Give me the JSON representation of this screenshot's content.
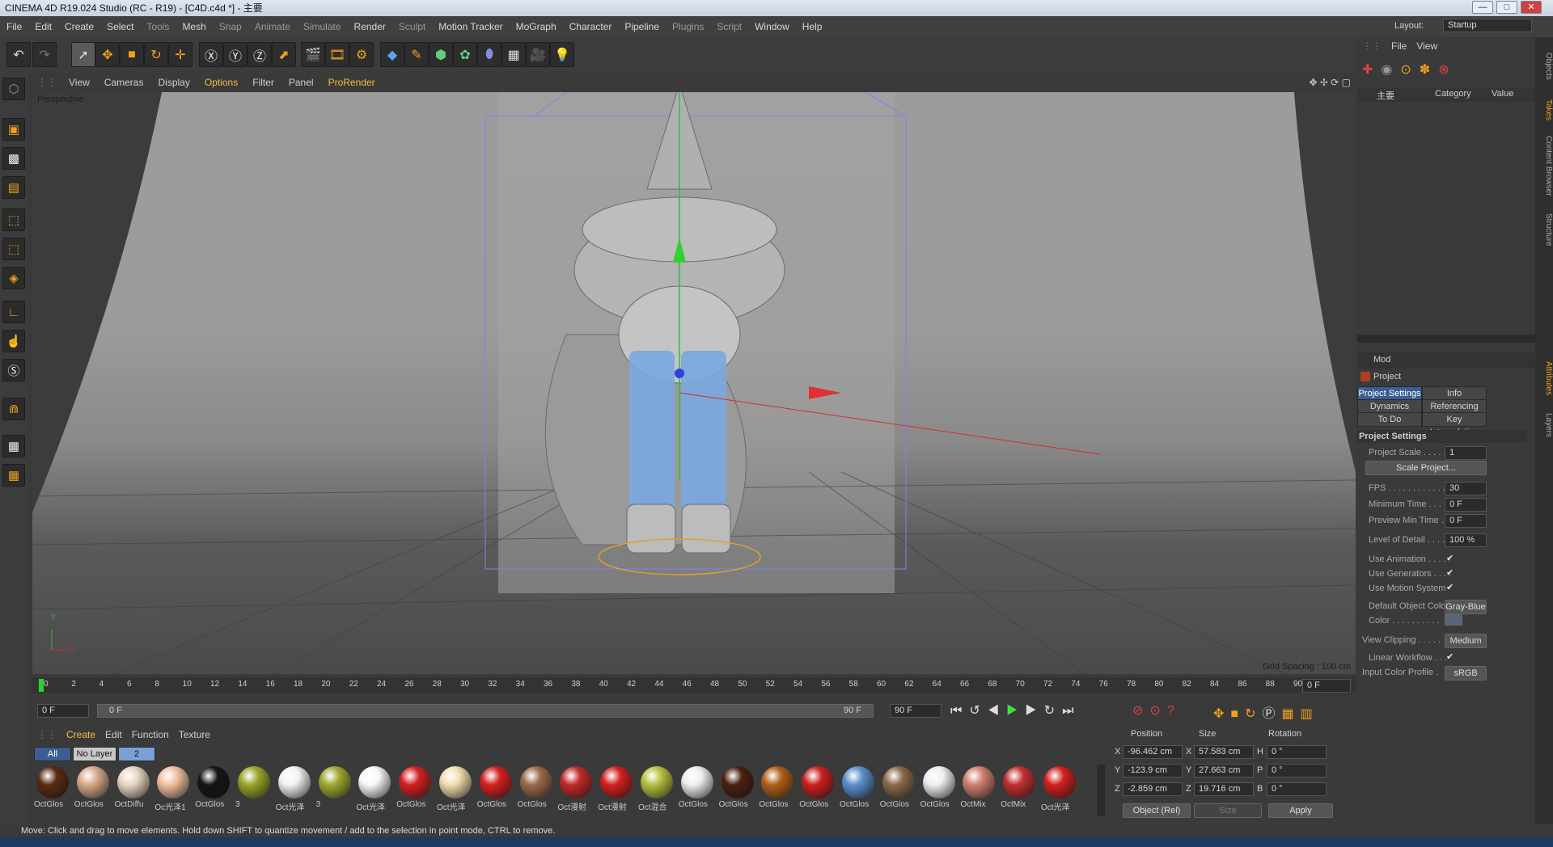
{
  "window": {
    "title": "CINEMA 4D R19.024 Studio (RC - R19) - [C4D.c4d *] - 主要",
    "minimize": "—",
    "maximize": "□",
    "close": "✕"
  },
  "menu": [
    "File",
    "Edit",
    "Create",
    "Select",
    "Tools",
    "Mesh",
    "Snap",
    "Animate",
    "Simulate",
    "Render",
    "Sculpt",
    "Motion Tracker",
    "MoGraph",
    "Character",
    "Pipeline",
    "Plugins",
    "Script",
    "Window",
    "Help"
  ],
  "layout": {
    "label": "Layout:",
    "value": "Startup"
  },
  "viewport_menu": [
    "View",
    "Cameras",
    "Display",
    "Options",
    "Filter",
    "Panel",
    "ProRender"
  ],
  "viewport": {
    "label": "Perspective",
    "grid_spacing": "Grid Spacing : 100 cm",
    "axis_y": "Y",
    "axis_x": "X"
  },
  "timeline": {
    "ticks": [
      "0",
      "2",
      "4",
      "6",
      "8",
      "10",
      "12",
      "14",
      "16",
      "18",
      "20",
      "22",
      "24",
      "26",
      "28",
      "30",
      "32",
      "34",
      "36",
      "38",
      "40",
      "42",
      "44",
      "46",
      "48",
      "50",
      "52",
      "54",
      "56",
      "58",
      "60",
      "62",
      "64",
      "66",
      "68",
      "70",
      "72",
      "74",
      "76",
      "78",
      "80",
      "82",
      "84",
      "86",
      "88",
      "90"
    ],
    "current_frame": "0 F"
  },
  "time_controls": {
    "start": "0 F",
    "range_start": "0 F",
    "range_end": "90 F",
    "end": "90 F"
  },
  "material_menu": [
    "Create",
    "Edit",
    "Function",
    "Texture"
  ],
  "layer_tabs": {
    "all": "All",
    "no_layer": "No Layer",
    "two": "2"
  },
  "materials": [
    {
      "name": "OctGlos",
      "color": "#5a2a14"
    },
    {
      "name": "OctGlos",
      "color": "#d7a98a"
    },
    {
      "name": "OctDiffu",
      "color": "#e8d6c4"
    },
    {
      "name": "Oc光泽1",
      "color": "#f0c0a0"
    },
    {
      "name": "OctGlos",
      "color": "#151515"
    },
    {
      "name": "3",
      "color": "#9aa52a"
    },
    {
      "name": "Oct光泽",
      "color": "#f2f2f2"
    },
    {
      "name": "3",
      "color": "#a0a830"
    },
    {
      "name": "Oct光泽",
      "color": "#f8f8f8"
    },
    {
      "name": "OctGlos",
      "color": "#d42020"
    },
    {
      "name": "Oct光泽",
      "color": "#f2deb0"
    },
    {
      "name": "OctGlos",
      "color": "#d42020"
    },
    {
      "name": "OctGlos",
      "color": "#9a6a4a"
    },
    {
      "name": "Oct漫射",
      "color": "#c42a2a"
    },
    {
      "name": "Oct漫射",
      "color": "#d42020"
    },
    {
      "name": "Oct混合",
      "color": "#b8c040"
    },
    {
      "name": "OctGlos",
      "color": "#eeeeee"
    },
    {
      "name": "OctGlos",
      "color": "#4a2010"
    },
    {
      "name": "OctGlos",
      "color": "#b0601a"
    },
    {
      "name": "OctGlos",
      "color": "#cc2020"
    },
    {
      "name": "OctGlos",
      "color": "#5a90d0"
    },
    {
      "name": "OctGlos",
      "color": "#8a6a4a"
    },
    {
      "name": "OctGlos",
      "color": "#eeeeee"
    },
    {
      "name": "OctMix",
      "color": "#d08070"
    },
    {
      "name": "OctMix",
      "color": "#c03030"
    },
    {
      "name": "Oct光泽",
      "color": "#d42020"
    }
  ],
  "coords": {
    "headers": {
      "position": "Position",
      "size": "Size",
      "rotation": "Rotation"
    },
    "x": {
      "label": "X",
      "pos": "-96.462 cm",
      "size": "57.583 cm",
      "rlabel": "H",
      "rot": "0 °"
    },
    "y": {
      "label": "Y",
      "pos": "-123.9 cm",
      "size": "27.663 cm",
      "rlabel": "P",
      "rot": "0 °"
    },
    "z": {
      "label": "Z",
      "pos": "-2.859 cm",
      "size": "19.716 cm",
      "rlabel": "B",
      "rot": "0 °"
    },
    "mode": "Object (Rel)",
    "size_mode": "Size",
    "apply": "Apply"
  },
  "objects_panel": {
    "menu": [
      "File",
      "View"
    ],
    "name_col": "主要",
    "category": "Category",
    "value": "Value"
  },
  "attributes": {
    "menu": "Mod",
    "header": "Project",
    "tabs": [
      [
        "Project Settings",
        "Info"
      ],
      [
        "Dynamics",
        "Referencing"
      ],
      [
        "To Do",
        "Key Interpolation"
      ]
    ],
    "section": "Project Settings",
    "fields": {
      "project_scale_label": "Project Scale . . . . . .",
      "project_scale": "1",
      "scale_button": "Scale Project...",
      "fps_label": "FPS . . . . . . . . . . . . . .",
      "fps": "30",
      "min_time_label": "Minimum Time . . . . .",
      "min_time": "0 F",
      "preview_min_label": "Preview Min Time . . .",
      "preview_min": "0 F",
      "lod_label": "Level of Detail . . . . .",
      "lod": "100 %",
      "use_anim_label": "Use Animation . . . . .",
      "use_anim": "✔",
      "use_gen_label": "Use Generators . . . .",
      "use_gen": "✔",
      "use_motion_label": "Use Motion System",
      "use_motion": "✔",
      "def_color_label": "Default Object Color",
      "def_color": "Gray-Blue",
      "color_label": "Color . . . . . . . . . .",
      "clip_label": "View Clipping . . . . .",
      "clip": "Medium",
      "linear_label": "Linear Workflow . . .",
      "linear": "✔",
      "input_profile_label": "Input Color Profile .",
      "input_profile": "sRGB"
    }
  },
  "side_tabs": [
    "Objects",
    "Takes",
    "Content Browser",
    "Structure",
    "Attributes",
    "Layers"
  ],
  "status": "Move: Click and drag to move elements. Hold down SHIFT to quantize movement / add to the selection in point mode, CTRL to remove.",
  "colors": {
    "accent": "#3b5d93",
    "orange": "#f0a020",
    "bg": "#3a3a3a"
  }
}
